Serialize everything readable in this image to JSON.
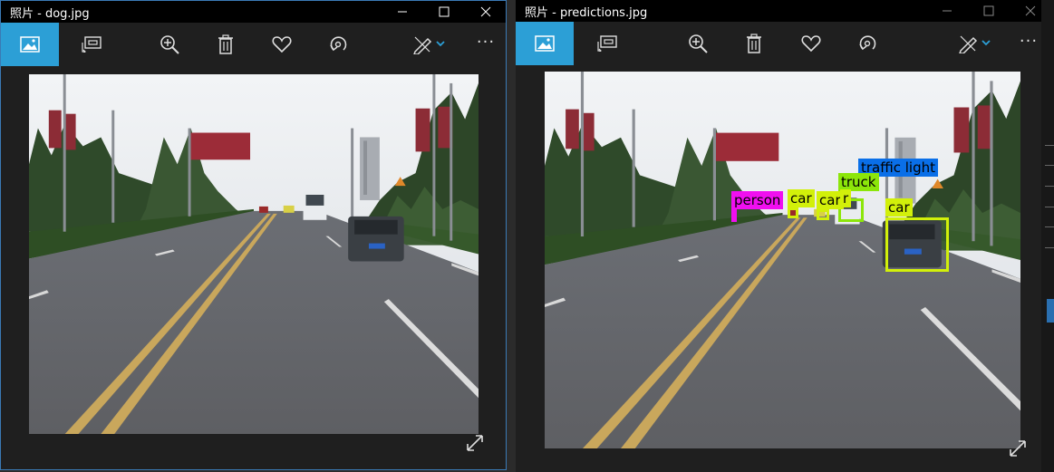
{
  "left_window": {
    "title": "照片 - dog.jpg",
    "toolbar": {
      "view_icon": "image-icon",
      "slideshow_icon": "slideshow-icon",
      "zoom_icon": "zoom-in-icon",
      "delete_icon": "trash-icon",
      "favorite_icon": "heart-icon",
      "rotate_icon": "rotate-icon",
      "edit_icon": "edit-pen-icon",
      "more_label": "···"
    }
  },
  "right_window": {
    "title": "照片 - predictions.jpg",
    "toolbar": {
      "view_icon": "image-icon",
      "slideshow_icon": "slideshow-icon",
      "zoom_icon": "zoom-in-icon",
      "delete_icon": "trash-icon",
      "favorite_icon": "heart-icon",
      "rotate_icon": "rotate-icon",
      "edit_icon": "edit-pen-icon",
      "more_label": "···"
    },
    "detections": [
      {
        "label": "traffic light",
        "color": "#0a6fe8"
      },
      {
        "label": "truck",
        "color": "#8ce60a"
      },
      {
        "label": "person",
        "color": "#f00ff0"
      },
      {
        "label": "car",
        "color": "#d2f00a"
      },
      {
        "label": "car",
        "color": "#d2f00a"
      },
      {
        "label": "r",
        "color": "#d2f00a"
      },
      {
        "label": "car",
        "color": "#d2f00a"
      }
    ]
  },
  "colors": {
    "accent": "#2c9fd6",
    "titlebar": "#000000",
    "window_bg": "#1f1f1f"
  }
}
